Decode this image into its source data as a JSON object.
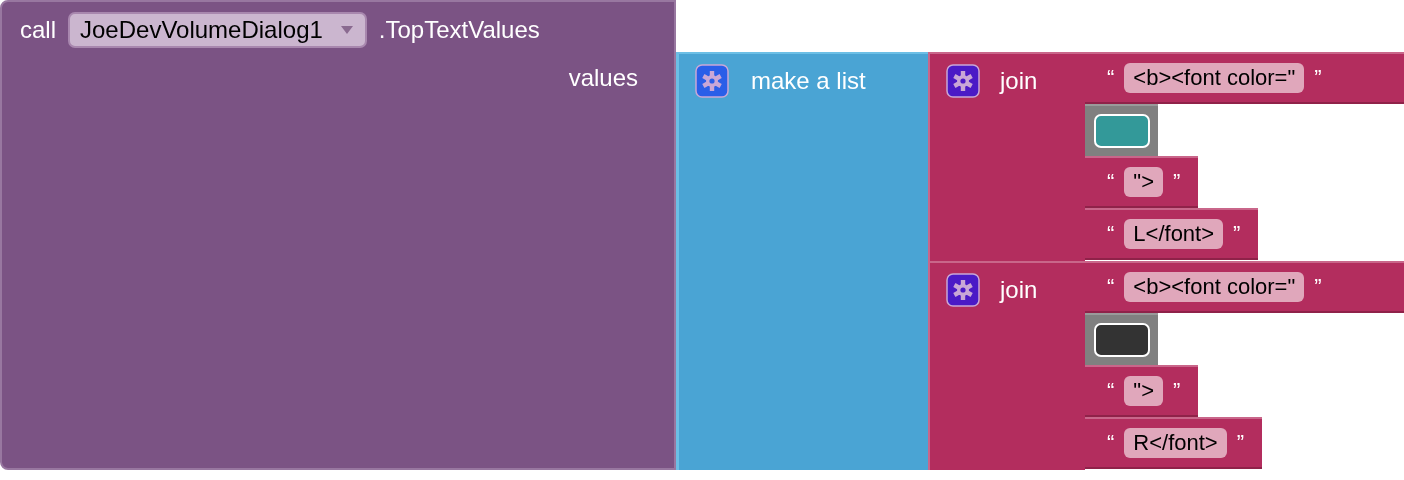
{
  "block": {
    "keyword": "call",
    "component": "JoeDevVolumeDialog1",
    "method": ".TopTextValues",
    "socket_label": "values",
    "list": {
      "label": "make a list",
      "items": [
        {
          "label": "join",
          "parts": [
            {
              "kind": "text",
              "open_quote": "“",
              "text": "<b><font color=\"",
              "close_quote": "”"
            },
            {
              "kind": "color",
              "color": "#339999"
            },
            {
              "kind": "text",
              "open_quote": "“",
              "text": "\">",
              "close_quote": "”"
            },
            {
              "kind": "text",
              "open_quote": "“",
              "text": "L</font>",
              "close_quote": "”"
            }
          ]
        },
        {
          "label": "join",
          "parts": [
            {
              "kind": "text",
              "open_quote": "“",
              "text": "<b><font color=\"",
              "close_quote": "”"
            },
            {
              "kind": "color",
              "color": "#333333"
            },
            {
              "kind": "text",
              "open_quote": "“",
              "text": "\">",
              "close_quote": "”"
            },
            {
              "kind": "text",
              "open_quote": "“",
              "text": "R</font>",
              "close_quote": "”"
            }
          ]
        }
      ]
    }
  }
}
